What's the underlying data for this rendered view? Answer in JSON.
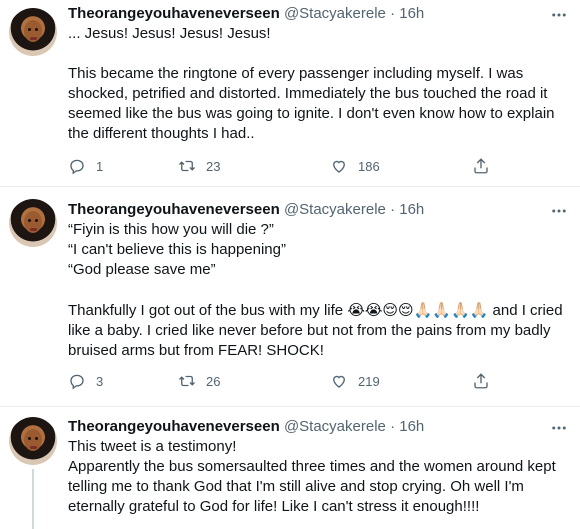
{
  "tweets": [
    {
      "name": "Theorangeyouhaveneverseen",
      "handle": "@Stacyakerele",
      "dot": "·",
      "time": "16h",
      "paragraphs": [
        "... Jesus! Jesus! Jesus! Jesus!",
        "This became the ringtone of every passenger including myself. I was shocked, petrified and distorted. Immediately the bus touched the road it seemed like the bus was going to ignite. I don't even know how to explain the different thoughts I had.."
      ],
      "replies": "1",
      "retweets": "23",
      "likes": "186"
    },
    {
      "name": "Theorangeyouhaveneverseen",
      "handle": "@Stacyakerele",
      "dot": "·",
      "time": "16h",
      "lines": [
        "“Fiyin is this how you will die ?”",
        "“I can't believe this is happening”",
        "“God please save me”"
      ],
      "para_before_emoji": "Thankfully I got out of the bus with my life ",
      "emojis": "😭😭😌😌🙏🏻🙏🏻🙏🏻🙏🏻",
      "para_after_emoji": " and I cried like a baby. I cried like never before but not from the pains from my badly bruised arms but from FEAR! SHOCK!",
      "replies": "3",
      "retweets": "26",
      "likes": "219"
    },
    {
      "name": "Theorangeyouhaveneverseen",
      "handle": "@Stacyakerele",
      "dot": "·",
      "time": "16h",
      "paragraphs": [
        "This tweet is a testimony!",
        "Apparently the bus somersaulted three times and the women around kept telling me to thank God that I'm still alive and stop crying. Oh well I'm eternally grateful to God for life! Like I can't stress it enough!!!!"
      ]
    }
  ],
  "icons": {
    "reply": "reply-icon",
    "retweet": "retweet-icon",
    "like": "heart-icon",
    "share": "share-icon",
    "more": "more-icon"
  },
  "colors": {
    "text": "#0f1419",
    "secondary": "#536471",
    "divider": "#ebeef0"
  }
}
